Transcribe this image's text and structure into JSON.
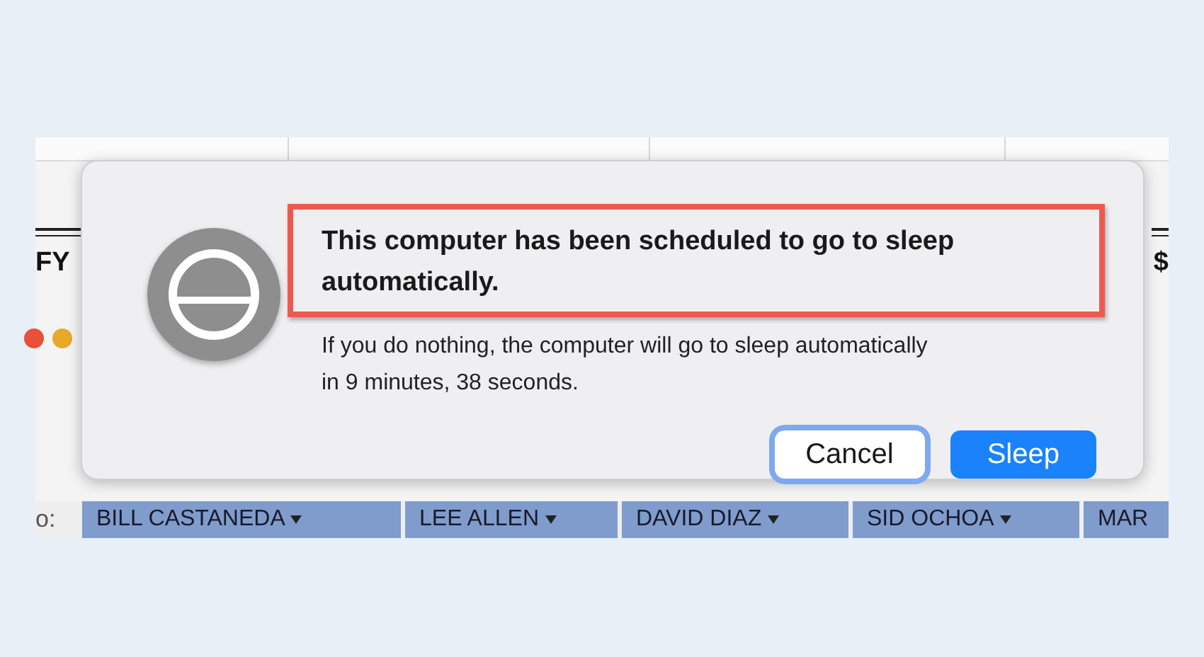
{
  "sheet": {
    "left_label": "FY",
    "right_label": "$",
    "status_dots": [
      {
        "color": "#e8503a"
      },
      {
        "color": "#e8a92a"
      }
    ],
    "row_label": "o:",
    "name_cells": [
      {
        "text": "BILL CASTANEDA"
      },
      {
        "text": "LEE ALLEN"
      },
      {
        "text": "DAVID DIAZ"
      },
      {
        "text": "SID OCHOA"
      },
      {
        "text": "MAR"
      }
    ]
  },
  "dialog": {
    "title": "This computer has been scheduled to go to sleep automatically.",
    "title_highlighted": true,
    "message": "If you do nothing, the computer will go to sleep automatically in 9 minutes, 38 seconds.",
    "buttons": [
      {
        "label": "Cancel",
        "kind": "secondary",
        "focused": true
      },
      {
        "label": "Sleep",
        "kind": "default",
        "focused": false
      }
    ]
  }
}
